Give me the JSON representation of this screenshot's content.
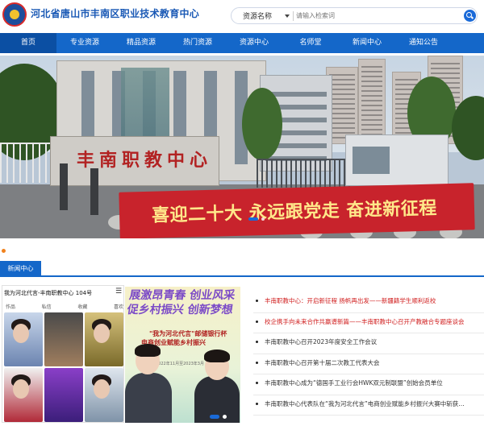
{
  "header": {
    "site_title": "河北省唐山市丰南区职业技术教育中心",
    "logo_icon": "school-emblem-icon"
  },
  "search": {
    "category": "资源名称",
    "placeholder": "请输入检索词",
    "button_icon": "search-icon"
  },
  "nav": {
    "items": [
      "首页",
      "专业资源",
      "精品资源",
      "热门资源",
      "资源中心",
      "名师堂",
      "新闻中心",
      "通知公告"
    ],
    "active_index": 0
  },
  "banner": {
    "gate_sign": "丰南职教中心",
    "slogan": "喜迎二十大  永远跟党走  奋进新征程",
    "active_slide": 0
  },
  "section": {
    "title": "新闻中心"
  },
  "phone": {
    "header": "我为河北代言-丰南职教中心 104号",
    "tabs": [
      "作品",
      "私信",
      "收藏",
      "喜欢"
    ]
  },
  "poster": {
    "title_line1": "展激昂青春 创业风采",
    "title_line2": "促乡村振兴 创新梦想",
    "sub_line1": "\"我为河北代言\"邮储银行杯",
    "sub_line2": "电商创业赋能乡村振兴",
    "date": "2022年11月至2023年3月"
  },
  "news": [
    {
      "text": "丰南职教中心：开启新征程 扬帆再出发——新疆籍学生顺利返校",
      "hot": true
    },
    {
      "text": "校企携手向未来合作共赢谱新篇——丰南职教中心召开产教融合专题座谈会",
      "hot": true
    },
    {
      "text": "丰南职教中心召开2023年度安全工作会议",
      "hot": false
    },
    {
      "text": "丰南职教中心召开第十届二次教工代表大会",
      "hot": false
    },
    {
      "text": "丰南职教中心成为“德国手工业行会HWK双元制联盟”创始会员单位",
      "hot": false
    },
    {
      "text": "丰南职教中心代表队在“我为河北代言”电商创业赋能乡村振兴大赛中斩获…",
      "hot": false
    }
  ],
  "colors": {
    "brand_blue": "#1467c9",
    "nav_active": "#0b4fa3",
    "headline_red": "#d01d1d",
    "banner_red": "#c8232c"
  }
}
